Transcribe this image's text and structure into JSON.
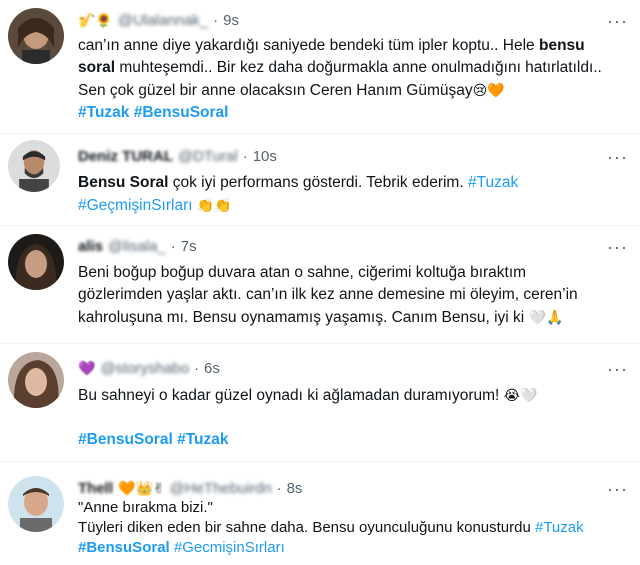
{
  "tweets": [
    {
      "name": "🎷🌻",
      "handle": "@Ulalannak_",
      "separator": "·",
      "time": "9s",
      "more": "···",
      "lines": [
        "can’ın anne diye yakardığı saniyede bendeki tüm ipler koptu.. Hele ",
        "bensu",
        "soral",
        " muhteşemdi.. Bir kez daha doğurmakla anne onulmadığını hatırlatıldı..",
        "Sen çok güzel bir anne olacaksın Ceren Hanım Gümüşay",
        "😢🧡"
      ],
      "tags": [
        "#Tuzak",
        "#BensuSoral"
      ]
    },
    {
      "name": "Deniz TURAL",
      "handle": "@DTural",
      "separator": "·",
      "time": "10s",
      "more": "···",
      "bold_lead": "Bensu Soral",
      "text": " çok iyi performans gösterdi. Tebrik ederim. ",
      "tag_inline": "#Tuzak",
      "tag_line2": "#GeçmişinSırları",
      "emoji": "👏👏"
    },
    {
      "name": "alis",
      "handle": "@lisala_",
      "separator": "·",
      "time": "7s",
      "more": "···",
      "lines": [
        "Beni boğup boğup duvara atan o sahne, ciğerimi koltuğa bıraktım",
        "gözlerimden yaşlar aktı. can’ın ilk kez anne demesine mi öleyim, ceren’in",
        "kahroluşuna mı. Bensu oynamamış yaşamış. Canım Bensu, iyi ki "
      ],
      "emoji": "🤍🙏"
    },
    {
      "name": "💜",
      "handle": "@storyshabo",
      "separator": "·",
      "time": "6s",
      "more": "···",
      "text": "Bu sahneyi o kadar güzel oynadı ki ağlamadan duramıyorum! ",
      "emoji": "😭🤍",
      "tags": [
        "#BensuSoral",
        "#Tuzak"
      ]
    },
    {
      "name": "Thell",
      "name_emoji": "🧡👑✌",
      "handle": "@HeThebuirdn",
      "separator": "·",
      "time": "8s",
      "more": "···",
      "quote": "\"Anne bırakma bizi.\"",
      "text": "Tüyleri diken eden bir sahne daha. Bensu oyunculuğunu konusturdu ",
      "tag_inline": "#Tuzak",
      "tags": [
        "#BensuSoral",
        "#GecmişinSırları"
      ]
    }
  ],
  "colors": {
    "link": "#1d9bf0",
    "text": "#0f1419",
    "muted": "#536471",
    "divider": "#eff3f4"
  }
}
